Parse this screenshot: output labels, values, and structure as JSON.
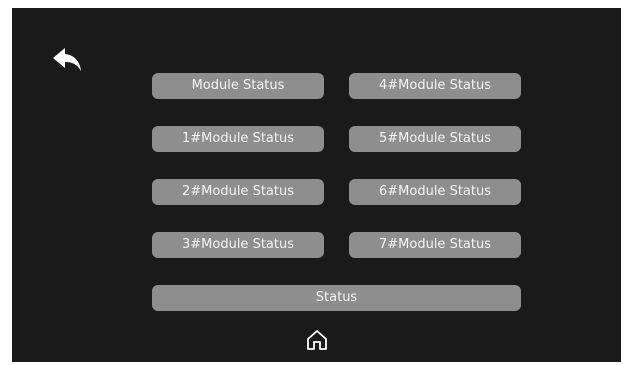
{
  "screen": {
    "back_icon": "back-arrow-icon",
    "home_icon": "home-icon",
    "left_column": [
      {
        "label": "Module Status"
      },
      {
        "label": "1#Module Status"
      },
      {
        "label": "2#Module Status"
      },
      {
        "label": "3#Module Status"
      }
    ],
    "right_column": [
      {
        "label": "4#Module Status"
      },
      {
        "label": "5#Module Status"
      },
      {
        "label": "6#Module Status"
      },
      {
        "label": "7#Module Status"
      }
    ],
    "status_label": "Status"
  },
  "colors": {
    "background": "#1a1a1a",
    "button": "#8e8e8e",
    "button_text": "#f4f4f4",
    "icon": "#ffffff"
  }
}
